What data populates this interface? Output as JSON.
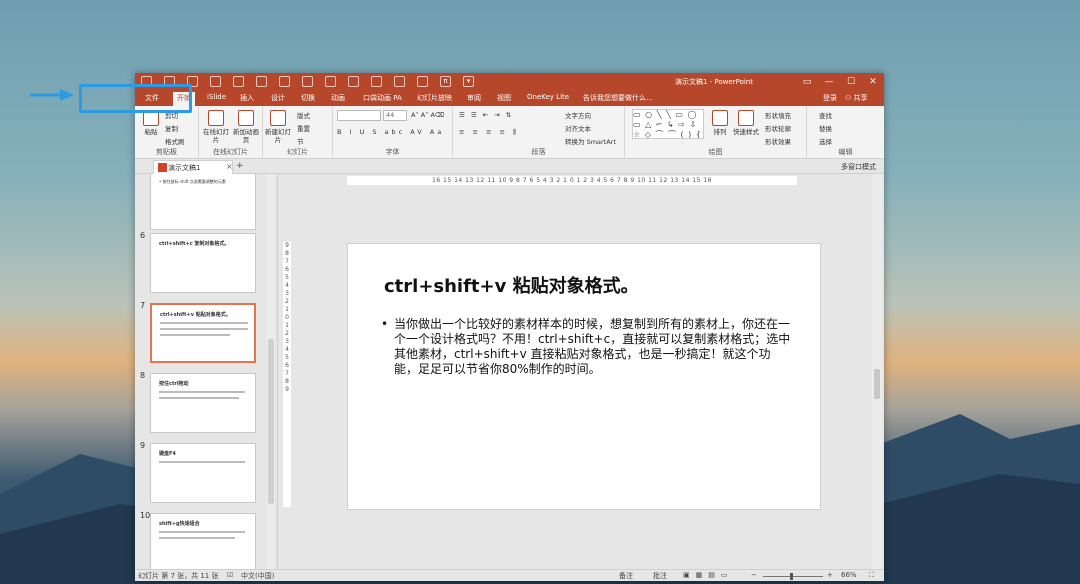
{
  "window": {
    "title": "演示文稿1 - PowerPoint"
  },
  "tabs": [
    "文件",
    "开始",
    "iSlide",
    "插入",
    "设计",
    "切换",
    "动画",
    "口袋动画 PA",
    "幻灯片放映",
    "审阅",
    "视图",
    "OneKey Lite"
  ],
  "tell_me": "告诉我您想要做什么...",
  "account": {
    "login": "登录",
    "share": "共享"
  },
  "ribbon": {
    "clipboard": {
      "label": "剪贴板",
      "paste": "粘贴",
      "cut": "剪切",
      "copy": "复制",
      "format_painter": "格式刷"
    },
    "new_slide_group": {
      "label": "在线幻灯片",
      "online": "在线幻灯片",
      "new": "新加动画页"
    },
    "slides": {
      "label": "幻灯片",
      "new_slide": "新建幻灯片",
      "layout": "版式",
      "reset": "重置",
      "section": "节"
    },
    "font": {
      "label": "字体",
      "size": "44"
    },
    "paragraph": {
      "label": "段落",
      "text_dir": "文字方向",
      "align_text": "对齐文本",
      "smartart": "转换为 SmartArt"
    },
    "drawing": {
      "label": "绘图",
      "arrange": "排列",
      "quick_styles": "快速样式",
      "fill": "形状填充",
      "outline": "形状轮廓",
      "effects": "形状效果"
    },
    "editing": {
      "label": "编辑",
      "find": "查找",
      "replace": "替换",
      "select": "选择"
    }
  },
  "doc_tab": {
    "name": "演示文稿1",
    "multi_mode": "多窗口模式"
  },
  "thumbnails": [
    {
      "num": "",
      "title": "",
      "note": "• 按住鼠标 shift 点选需要调整的元素"
    },
    {
      "num": "6",
      "title": "ctrl+shift+c 复制对象格式。",
      "note": ""
    },
    {
      "num": "7",
      "title": "ctrl+shift+v 粘贴对象格式。",
      "note": ""
    },
    {
      "num": "8",
      "title": "按住ctrl拖动",
      "note": ""
    },
    {
      "num": "9",
      "title": "键盘F4",
      "note": ""
    },
    {
      "num": "10",
      "title": "shift+g快速组合",
      "note": ""
    }
  ],
  "ruler": {
    "h": "16 15 14 13 12 11 10 9 8 7 6 5 4 3 2 1 0 1 2 3 4 5 6 7 8 9 10 11 12 13 14 15 16",
    "v": "9 8 7 6 5 4 3 2 1 0 1 2 3 4 5 6 7 8 9"
  },
  "slide": {
    "title": "ctrl+shift+v 粘贴对象格式。",
    "bullet": "当你做出一个比较好的素材样本的时候，想复制到所有的素材上，你还在一个一个设计格式吗？不用！ctrl+shift+c，直接就可以复制素材格式；选中其他素材，ctrl+shift+v 直接粘贴对象格式，也是一秒搞定！就这个功能，足足可以节省你80%制作的时间。"
  },
  "status": {
    "slide_info": "幻灯片 第 7 张，共 11 张",
    "lang": "中文(中国)",
    "notes": "备注",
    "comments": "批注",
    "zoom": "66%"
  },
  "colors": {
    "accent": "#b7472a",
    "highlight": "#2b9be6",
    "selected_thumb": "#e6734f"
  }
}
